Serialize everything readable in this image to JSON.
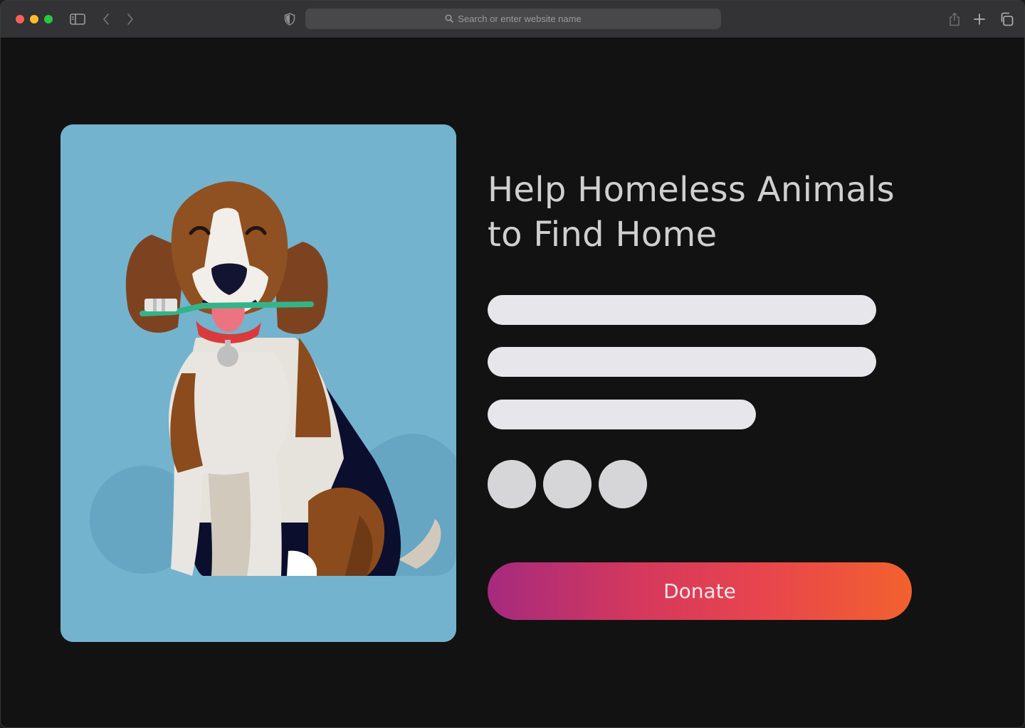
{
  "browser": {
    "address_placeholder": "Search or enter website name",
    "traffic_light_colors": {
      "close": "#fe5f57",
      "minimize": "#febc2e",
      "zoom": "#28c840"
    }
  },
  "hero": {
    "title_line1": "Help Homeless Animals",
    "title_line2": "to Find Home",
    "donate_label": "Donate",
    "donate_gradient": [
      "#a52a7e",
      "#d4385d",
      "#e8454d",
      "#f2612e"
    ],
    "illustration": "beagle-with-toothbrush"
  },
  "colors": {
    "page_bg": "#121212",
    "card_bg": "#73b3ce",
    "text_placeholder_bars": "#e6e6eb",
    "title": "#d0d0d2"
  }
}
